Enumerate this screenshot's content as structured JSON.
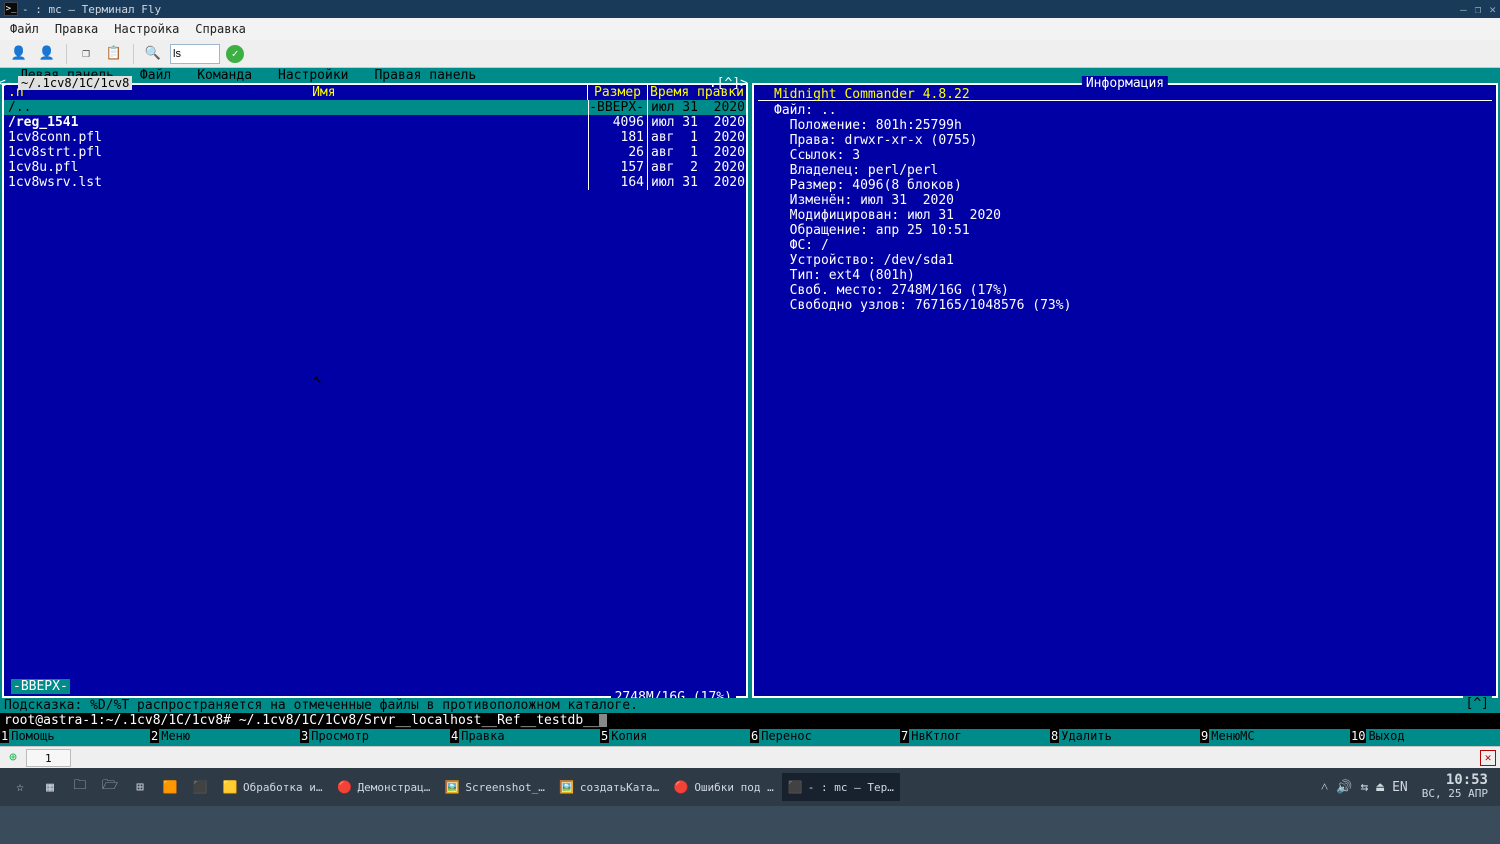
{
  "window": {
    "title": "- : mc — Терминал Fly",
    "menu": [
      "Файл",
      "Правка",
      "Настройка",
      "Справка"
    ],
    "toolbar_cmd": "ls"
  },
  "mc_menu": [
    "Левая панель",
    "Файл",
    "Команда",
    "Настройки",
    "Правая панель"
  ],
  "left_panel": {
    "path": "~/.1cv8/1C/1cv8",
    "corner_l": "<-",
    "corner_r": ".[^]>",
    "headers": {
      "n": ".n",
      "name": "Имя",
      "size": "Размер",
      "date": "Время правки"
    },
    "rows": [
      {
        "name": "/..",
        "size": "-ВВЕРХ-",
        "date": "июл 31  2020",
        "sel": true
      },
      {
        "name": "/reg_1541",
        "size": "4096",
        "date": "июл 31  2020",
        "dir": true
      },
      {
        "name": " 1cv8conn.pfl",
        "size": "181",
        "date": "авг  1  2020"
      },
      {
        "name": " 1cv8strt.pfl",
        "size": "26",
        "date": "авг  1  2020"
      },
      {
        "name": " 1cv8u.pfl",
        "size": "157",
        "date": "авг  2  2020"
      },
      {
        "name": " 1cv8wsrv.lst",
        "size": "164",
        "date": "июл 31  2020"
      }
    ],
    "footer": "-ВВЕРХ-",
    "disk": "2748M/16G (17%)"
  },
  "right_panel": {
    "title": "Информация",
    "version": "Midnight Commander 4.8.22",
    "info": [
      "Файл: ..",
      "  Положение: 801h:25799h",
      "  Права: drwxr-xr-x (0755)",
      "  Ссылок: 3",
      "  Владелец: perl/perl",
      "  Размер: 4096(8 блоков)",
      "  Изменён: июл 31  2020",
      "  Модифицирован: июл 31  2020",
      "  Обращение: апр 25 10:51",
      "  ФС: /",
      "  Устройство: /dev/sda1",
      "  Тип: ext4 (801h)",
      "  Своб. место: 2748M/16G (17%)",
      "  Свободно узлов: 767165/1048576 (73%)"
    ]
  },
  "hint": "Подсказка: %D/%T распространяется на отмеченные файлы в противоположном каталоге.",
  "prompt": {
    "user": "root@astra-1:~/.1cv8/1C/1cv8# ",
    "cmd": "~/.1cv8/1C/1Cv8/Srvr__localhost__Ref__testdb__"
  },
  "lang_ind": "[^]",
  "fkeys": [
    {
      "n": "1",
      "l": "Помощь"
    },
    {
      "n": "2",
      "l": "Меню"
    },
    {
      "n": "3",
      "l": "Просмотр"
    },
    {
      "n": "4",
      "l": "Правка"
    },
    {
      "n": "5",
      "l": "Копия"
    },
    {
      "n": "6",
      "l": "Перенос"
    },
    {
      "n": "7",
      "l": "НвКтлог"
    },
    {
      "n": "8",
      "l": "Удалить"
    },
    {
      "n": "9",
      "l": "МенюMC"
    },
    {
      "n": "10",
      "l": "Выход"
    }
  ],
  "tabbar": {
    "tab": "1"
  },
  "tasks": [
    {
      "icon": "🟧",
      "label": "",
      "bg": "#e07030",
      "active": false
    },
    {
      "icon": "⬛",
      "label": "",
      "bg": "#303030",
      "active": false
    },
    {
      "icon": "🟨",
      "label": "Обработка и…",
      "active": false
    },
    {
      "icon": "🔴",
      "label": "Демонстрац…",
      "active": false
    },
    {
      "icon": "🖼️",
      "label": "Screenshot_…",
      "active": false
    },
    {
      "icon": "🖼️",
      "label": "создатьКата…",
      "active": false
    },
    {
      "icon": "🔴",
      "label": "Ошибки под …",
      "active": false
    },
    {
      "icon": "⬛",
      "label": "- : mc — Тер…",
      "active": true
    }
  ],
  "tray": {
    "lang": "EN",
    "time": "10:53",
    "date": "ВС, 25 АПР"
  }
}
